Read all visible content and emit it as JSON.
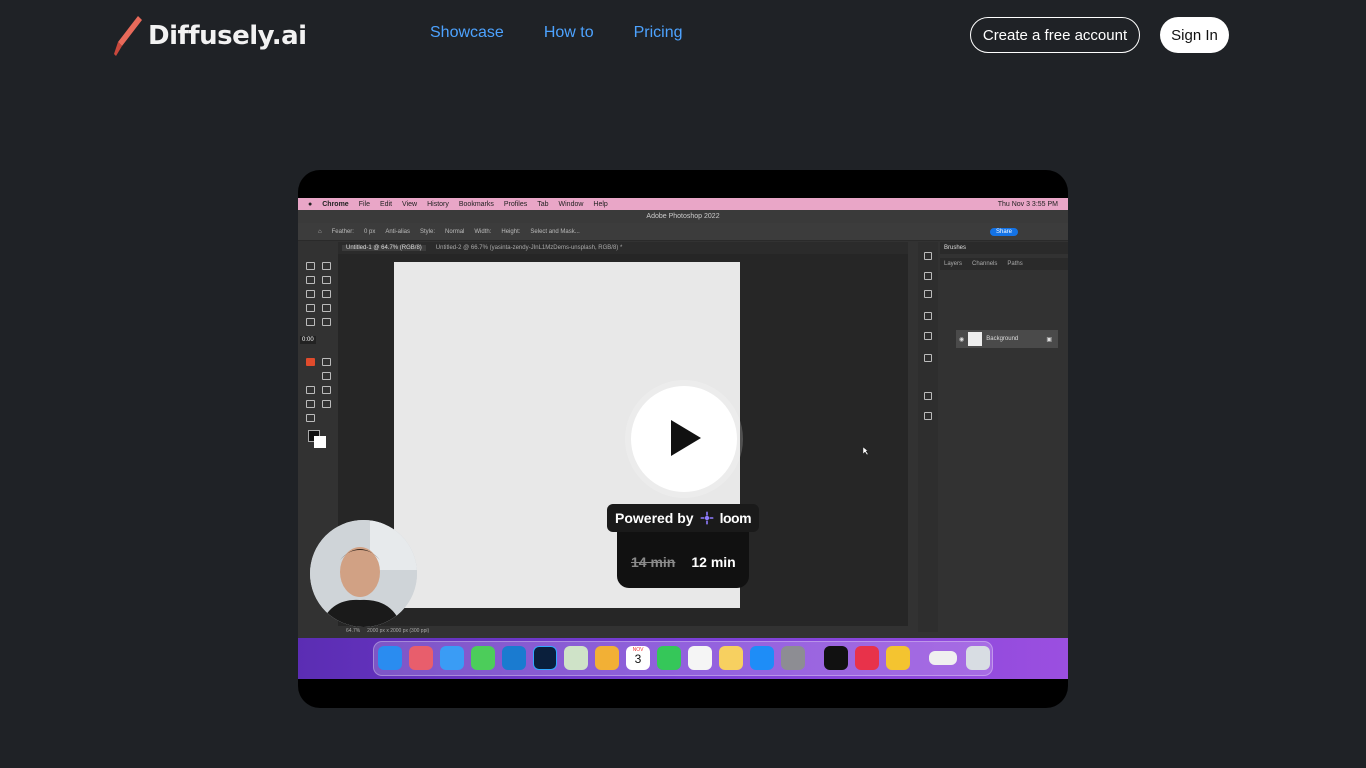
{
  "brand": {
    "name": "Diffusely.ai"
  },
  "nav": {
    "links": [
      "Showcase",
      "How to",
      "Pricing"
    ]
  },
  "auth": {
    "create_label": "Create a free account",
    "signin_label": "Sign In"
  },
  "video": {
    "mac_menu": [
      "Chrome",
      "File",
      "Edit",
      "View",
      "History",
      "Bookmarks",
      "Profiles",
      "Tab",
      "Window",
      "Help"
    ],
    "clock": "Thu Nov 3  3:55 PM",
    "ps_title": "Adobe Photoshop 2022",
    "options": {
      "feather_label": "Feather:",
      "feather_value": "0 px",
      "antialias": "Anti-alias",
      "style_label": "Style:",
      "style_value": "Normal",
      "width_label": "Width:",
      "height_label": "Height:",
      "select_mask": "Select and Mask...",
      "share": "Share"
    },
    "doc_tabs": [
      "Untitled-1 @ 64.7% (RGB/8)",
      "Untitled-2 @ 66.7% (yasinta-zendy-JInL1MzDems-unsplash, RGB/8) *"
    ],
    "panel_title": "Brushes",
    "panel_tabs": [
      "Layers",
      "Channels",
      "Paths"
    ],
    "layer_name": "Background",
    "status": {
      "zoom": "64.7%",
      "size": "2000 px x 2000 px (300 ppi)"
    },
    "timer": "0:00",
    "speed": {
      "old": "14 min",
      "new": "12 min"
    },
    "powered": {
      "label": "Powered by",
      "brand": "loom"
    },
    "calendar": {
      "month": "NOV",
      "day": "3"
    }
  },
  "colors": {
    "accent_link": "#4da3ff",
    "background": "#1f2226",
    "dock": "#7a3fd6",
    "menubar": "#e9a6c7"
  }
}
